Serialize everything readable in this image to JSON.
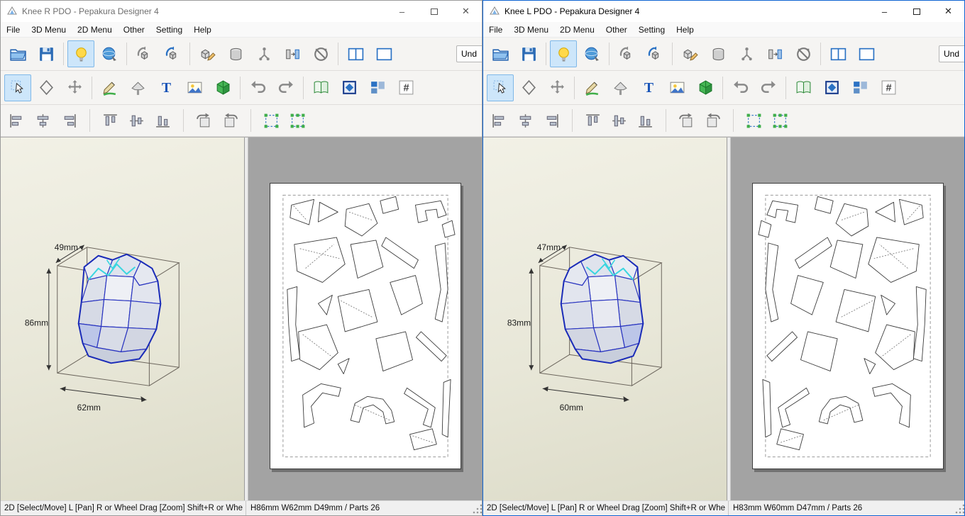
{
  "app": {
    "name": "Pepakura Designer 4",
    "accent_color": "#0f64d2",
    "viewport3d_bg": "#e9e8da",
    "viewport2d_bg": "#a3a3a3"
  },
  "window_controls": {
    "minimize": "–",
    "close": "✕"
  },
  "menu_items": [
    "File",
    "3D Menu",
    "2D Menu",
    "Other",
    "Setting",
    "Help"
  ],
  "toolbars": {
    "main": [
      {
        "name": "open-file"
      },
      {
        "name": "save-file"
      },
      {
        "sep": true
      },
      {
        "name": "texture-light",
        "active": true
      },
      {
        "name": "texture-sphere"
      },
      {
        "sep": true
      },
      {
        "name": "rotate-object"
      },
      {
        "name": "rotate-object-free"
      },
      {
        "sep": true
      },
      {
        "name": "edit-solid"
      },
      {
        "name": "primitive-cylinder"
      },
      {
        "name": "joint-axis"
      },
      {
        "name": "flip-parts"
      },
      {
        "name": "reset-view"
      },
      {
        "sep": true
      },
      {
        "name": "layout-two-pane"
      },
      {
        "name": "layout-single-pane"
      },
      {
        "name": "undo-history",
        "label": "Und"
      }
    ],
    "edit": [
      {
        "name": "select-tool",
        "active": true
      },
      {
        "name": "poly-select"
      },
      {
        "name": "move-parts"
      },
      {
        "sep": true
      },
      {
        "name": "edge-color-pen"
      },
      {
        "name": "flap-tool"
      },
      {
        "name": "text-tool"
      },
      {
        "name": "image-tool"
      },
      {
        "name": "material-cube"
      },
      {
        "sep": true
      },
      {
        "name": "undo"
      },
      {
        "name": "redo"
      },
      {
        "sep": true
      },
      {
        "name": "unfold-book"
      },
      {
        "name": "select-frame"
      },
      {
        "name": "arrange-parts"
      },
      {
        "name": "number-display"
      }
    ],
    "align": [
      {
        "name": "align-left"
      },
      {
        "name": "align-center"
      },
      {
        "name": "align-right"
      },
      {
        "sep": true
      },
      {
        "name": "align-top"
      },
      {
        "name": "align-middle"
      },
      {
        "name": "align-bottom"
      },
      {
        "sep": true
      },
      {
        "name": "rotate-ccw"
      },
      {
        "name": "rotate-cw"
      },
      {
        "sep": true
      },
      {
        "name": "group-select"
      },
      {
        "name": "select-handles"
      }
    ]
  },
  "windows": [
    {
      "title": "Knee R PDO - Pepakura Designer 4",
      "active": false,
      "dims": {
        "height": "86mm",
        "width": "62mm",
        "depth": "49mm"
      },
      "status_left": "2D [Select/Move] L [Pan] R or Wheel Drag [Zoom] Shift+R or Whe",
      "status_right": "H86mm W62mm D49mm / Parts 26"
    },
    {
      "title": "Knee L PDO - Pepakura Designer 4",
      "active": true,
      "dims": {
        "height": "83mm",
        "width": "60mm",
        "depth": "47mm"
      },
      "status_left": "2D [Select/Move] L [Pan] R or Wheel Drag [Zoom] Shift+R or Whe",
      "status_right": "H83mm W60mm D47mm / Parts 26"
    }
  ]
}
